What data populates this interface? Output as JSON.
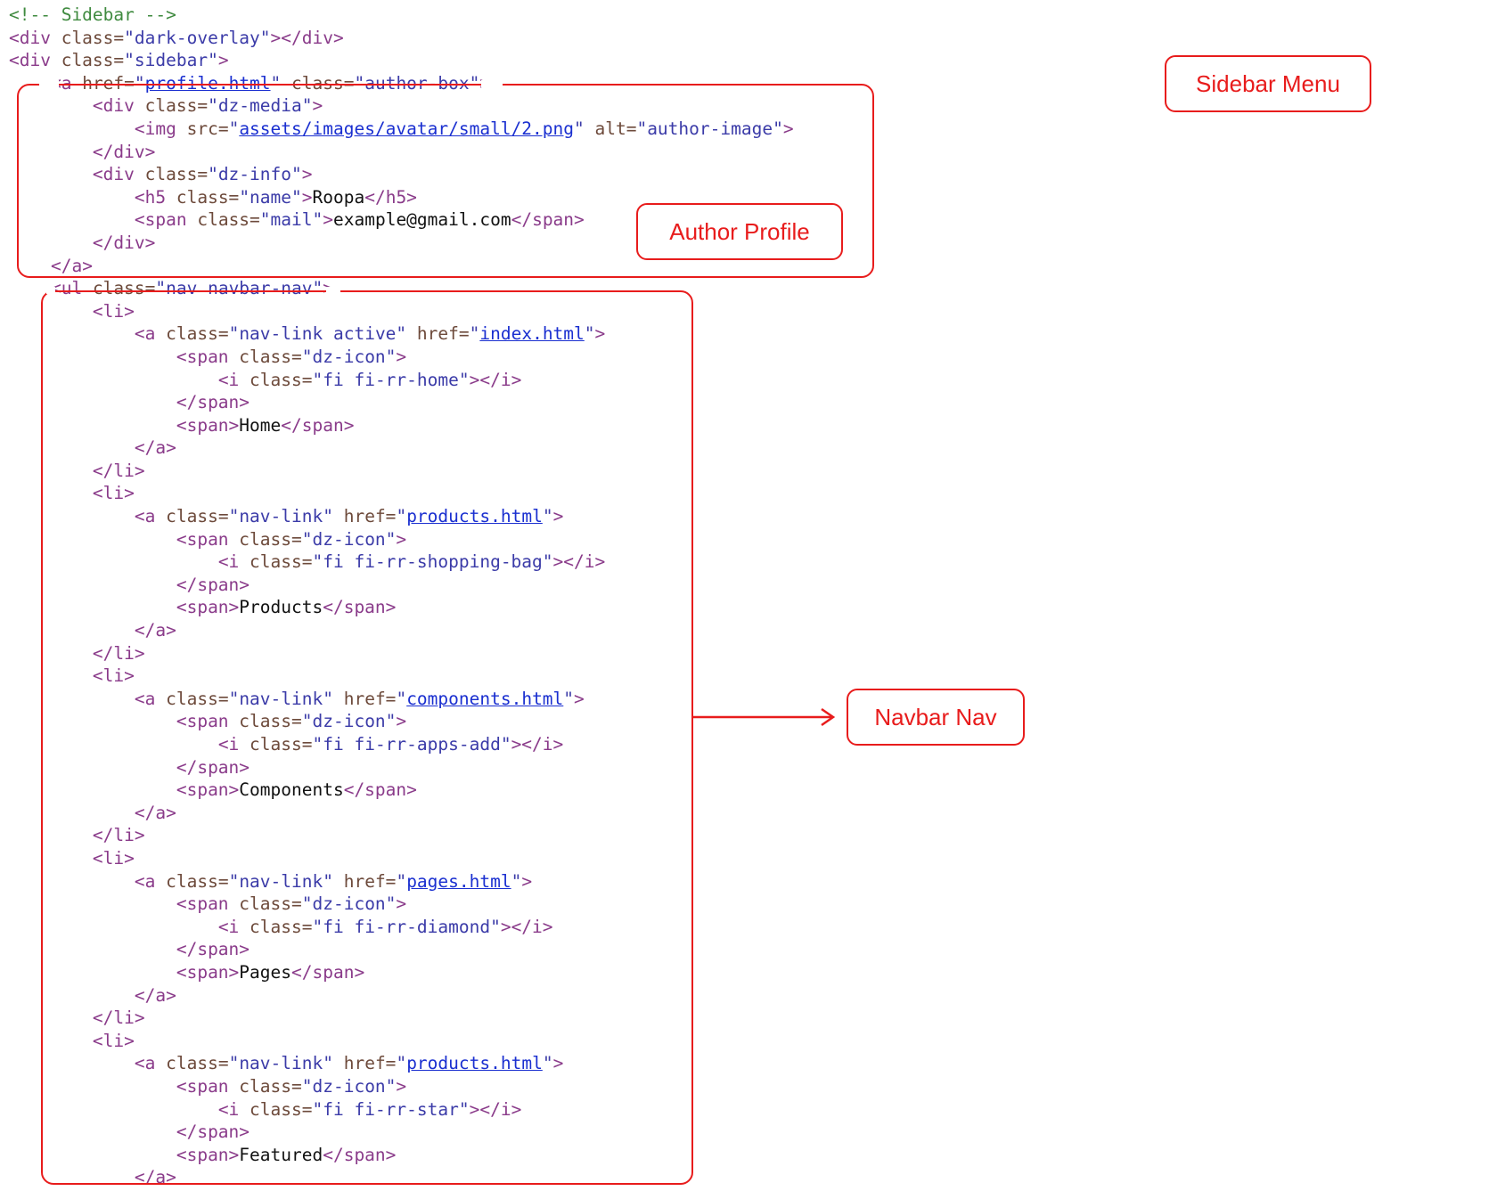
{
  "labels": {
    "sidebar_menu": "Sidebar Menu",
    "author_profile": "Author Profile",
    "navbar_nav": "Navbar Nav"
  },
  "colors": {
    "annotation": "#e81c1c",
    "comment": "#3f8a3f",
    "tag": "#8a3b8a",
    "attr": "#6d4a3b",
    "value": "#3b3ba8",
    "link": "#1a2fd0",
    "text": "#111111"
  },
  "code_lines": [
    {
      "indent": 0,
      "tokens": [
        {
          "t": "comment",
          "v": "<!-- Sidebar -->"
        }
      ]
    },
    {
      "indent": 0,
      "tokens": [
        {
          "t": "tag",
          "v": "<div "
        },
        {
          "t": "attr",
          "v": "class="
        },
        {
          "t": "val",
          "v": "\"dark-overlay\""
        },
        {
          "t": "tag",
          "v": "></div>"
        }
      ]
    },
    {
      "indent": 0,
      "tokens": [
        {
          "t": "tag",
          "v": "<div "
        },
        {
          "t": "attr",
          "v": "class="
        },
        {
          "t": "val",
          "v": "\"sidebar\""
        },
        {
          "t": "tag",
          "v": ">"
        }
      ]
    },
    {
      "indent": 1,
      "tokens": [
        {
          "t": "tag",
          "v": "<a "
        },
        {
          "t": "attr",
          "v": "href="
        },
        {
          "t": "val",
          "v": "\""
        },
        {
          "t": "link",
          "v": "profile.html"
        },
        {
          "t": "val",
          "v": "\""
        },
        {
          "t": "attr",
          "v": " class="
        },
        {
          "t": "val",
          "v": "\"author-box\""
        },
        {
          "t": "tag",
          "v": ">"
        }
      ]
    },
    {
      "indent": 2,
      "tokens": [
        {
          "t": "tag",
          "v": "<div "
        },
        {
          "t": "attr",
          "v": "class="
        },
        {
          "t": "val",
          "v": "\"dz-media\""
        },
        {
          "t": "tag",
          "v": ">"
        }
      ]
    },
    {
      "indent": 3,
      "tokens": [
        {
          "t": "tag",
          "v": "<img "
        },
        {
          "t": "attr",
          "v": "src="
        },
        {
          "t": "val",
          "v": "\""
        },
        {
          "t": "link",
          "v": "assets/images/avatar/small/2.png"
        },
        {
          "t": "val",
          "v": "\""
        },
        {
          "t": "attr",
          "v": " alt="
        },
        {
          "t": "val",
          "v": "\"author-image\""
        },
        {
          "t": "tag",
          "v": ">"
        }
      ]
    },
    {
      "indent": 2,
      "tokens": [
        {
          "t": "tag",
          "v": "</div>"
        }
      ]
    },
    {
      "indent": 2,
      "tokens": [
        {
          "t": "tag",
          "v": "<div "
        },
        {
          "t": "attr",
          "v": "class="
        },
        {
          "t": "val",
          "v": "\"dz-info\""
        },
        {
          "t": "tag",
          "v": ">"
        }
      ]
    },
    {
      "indent": 3,
      "tokens": [
        {
          "t": "tag",
          "v": "<h5 "
        },
        {
          "t": "attr",
          "v": "class="
        },
        {
          "t": "val",
          "v": "\"name\""
        },
        {
          "t": "tag",
          "v": ">"
        },
        {
          "t": "text",
          "v": "Roopa"
        },
        {
          "t": "tag",
          "v": "</h5>"
        }
      ]
    },
    {
      "indent": 3,
      "tokens": [
        {
          "t": "tag",
          "v": "<span "
        },
        {
          "t": "attr",
          "v": "class="
        },
        {
          "t": "val",
          "v": "\"mail\""
        },
        {
          "t": "tag",
          "v": ">"
        },
        {
          "t": "text",
          "v": "example@gmail.com"
        },
        {
          "t": "tag",
          "v": "</span>"
        }
      ]
    },
    {
      "indent": 2,
      "tokens": [
        {
          "t": "tag",
          "v": "</div>"
        }
      ]
    },
    {
      "indent": 1,
      "tokens": [
        {
          "t": "tag",
          "v": "</a>"
        }
      ]
    },
    {
      "indent": 1,
      "tokens": [
        {
          "t": "tag",
          "v": "<ul "
        },
        {
          "t": "attr",
          "v": "class="
        },
        {
          "t": "val",
          "v": "\"nav navbar-nav\""
        },
        {
          "t": "tag",
          "v": ">"
        }
      ]
    },
    {
      "indent": 2,
      "tokens": [
        {
          "t": "tag",
          "v": "<li>"
        }
      ]
    },
    {
      "indent": 3,
      "tokens": [
        {
          "t": "tag",
          "v": "<a "
        },
        {
          "t": "attr",
          "v": "class="
        },
        {
          "t": "val",
          "v": "\"nav-link active\""
        },
        {
          "t": "attr",
          "v": " href="
        },
        {
          "t": "val",
          "v": "\""
        },
        {
          "t": "link",
          "v": "index.html"
        },
        {
          "t": "val",
          "v": "\""
        },
        {
          "t": "tag",
          "v": ">"
        }
      ]
    },
    {
      "indent": 4,
      "tokens": [
        {
          "t": "tag",
          "v": "<span "
        },
        {
          "t": "attr",
          "v": "class="
        },
        {
          "t": "val",
          "v": "\"dz-icon\""
        },
        {
          "t": "tag",
          "v": ">"
        }
      ]
    },
    {
      "indent": 5,
      "tokens": [
        {
          "t": "tag",
          "v": "<i "
        },
        {
          "t": "attr",
          "v": "class="
        },
        {
          "t": "val",
          "v": "\"fi fi-rr-home\""
        },
        {
          "t": "tag",
          "v": "></i>"
        }
      ]
    },
    {
      "indent": 4,
      "tokens": [
        {
          "t": "tag",
          "v": "</span>"
        }
      ]
    },
    {
      "indent": 4,
      "tokens": [
        {
          "t": "tag",
          "v": "<span>"
        },
        {
          "t": "text",
          "v": "Home"
        },
        {
          "t": "tag",
          "v": "</span>"
        }
      ]
    },
    {
      "indent": 3,
      "tokens": [
        {
          "t": "tag",
          "v": "</a>"
        }
      ]
    },
    {
      "indent": 2,
      "tokens": [
        {
          "t": "tag",
          "v": "</li>"
        }
      ]
    },
    {
      "indent": 2,
      "tokens": [
        {
          "t": "tag",
          "v": "<li>"
        }
      ]
    },
    {
      "indent": 3,
      "tokens": [
        {
          "t": "tag",
          "v": "<a "
        },
        {
          "t": "attr",
          "v": "class="
        },
        {
          "t": "val",
          "v": "\"nav-link\""
        },
        {
          "t": "attr",
          "v": " href="
        },
        {
          "t": "val",
          "v": "\""
        },
        {
          "t": "link",
          "v": "products.html"
        },
        {
          "t": "val",
          "v": "\""
        },
        {
          "t": "tag",
          "v": ">"
        }
      ]
    },
    {
      "indent": 4,
      "tokens": [
        {
          "t": "tag",
          "v": "<span "
        },
        {
          "t": "attr",
          "v": "class="
        },
        {
          "t": "val",
          "v": "\"dz-icon\""
        },
        {
          "t": "tag",
          "v": ">"
        }
      ]
    },
    {
      "indent": 5,
      "tokens": [
        {
          "t": "tag",
          "v": "<i "
        },
        {
          "t": "attr",
          "v": "class="
        },
        {
          "t": "val",
          "v": "\"fi fi-rr-shopping-bag\""
        },
        {
          "t": "tag",
          "v": "></i>"
        }
      ]
    },
    {
      "indent": 4,
      "tokens": [
        {
          "t": "tag",
          "v": "</span>"
        }
      ]
    },
    {
      "indent": 4,
      "tokens": [
        {
          "t": "tag",
          "v": "<span>"
        },
        {
          "t": "text",
          "v": "Products"
        },
        {
          "t": "tag",
          "v": "</span>"
        }
      ]
    },
    {
      "indent": 3,
      "tokens": [
        {
          "t": "tag",
          "v": "</a>"
        }
      ]
    },
    {
      "indent": 2,
      "tokens": [
        {
          "t": "tag",
          "v": "</li>"
        }
      ]
    },
    {
      "indent": 2,
      "tokens": [
        {
          "t": "tag",
          "v": "<li>"
        }
      ]
    },
    {
      "indent": 3,
      "tokens": [
        {
          "t": "tag",
          "v": "<a "
        },
        {
          "t": "attr",
          "v": "class="
        },
        {
          "t": "val",
          "v": "\"nav-link\""
        },
        {
          "t": "attr",
          "v": " href="
        },
        {
          "t": "val",
          "v": "\""
        },
        {
          "t": "link",
          "v": "components.html"
        },
        {
          "t": "val",
          "v": "\""
        },
        {
          "t": "tag",
          "v": ">"
        }
      ]
    },
    {
      "indent": 4,
      "tokens": [
        {
          "t": "tag",
          "v": "<span "
        },
        {
          "t": "attr",
          "v": "class="
        },
        {
          "t": "val",
          "v": "\"dz-icon\""
        },
        {
          "t": "tag",
          "v": ">"
        }
      ]
    },
    {
      "indent": 5,
      "tokens": [
        {
          "t": "tag",
          "v": "<i "
        },
        {
          "t": "attr",
          "v": "class="
        },
        {
          "t": "val",
          "v": "\"fi fi-rr-apps-add\""
        },
        {
          "t": "tag",
          "v": "></i>"
        }
      ]
    },
    {
      "indent": 4,
      "tokens": [
        {
          "t": "tag",
          "v": "</span>"
        }
      ]
    },
    {
      "indent": 4,
      "tokens": [
        {
          "t": "tag",
          "v": "<span>"
        },
        {
          "t": "text",
          "v": "Components"
        },
        {
          "t": "tag",
          "v": "</span>"
        }
      ]
    },
    {
      "indent": 3,
      "tokens": [
        {
          "t": "tag",
          "v": "</a>"
        }
      ]
    },
    {
      "indent": 2,
      "tokens": [
        {
          "t": "tag",
          "v": "</li>"
        }
      ]
    },
    {
      "indent": 2,
      "tokens": [
        {
          "t": "tag",
          "v": "<li>"
        }
      ]
    },
    {
      "indent": 3,
      "tokens": [
        {
          "t": "tag",
          "v": "<a "
        },
        {
          "t": "attr",
          "v": "class="
        },
        {
          "t": "val",
          "v": "\"nav-link\""
        },
        {
          "t": "attr",
          "v": " href="
        },
        {
          "t": "val",
          "v": "\""
        },
        {
          "t": "link",
          "v": "pages.html"
        },
        {
          "t": "val",
          "v": "\""
        },
        {
          "t": "tag",
          "v": ">"
        }
      ]
    },
    {
      "indent": 4,
      "tokens": [
        {
          "t": "tag",
          "v": "<span "
        },
        {
          "t": "attr",
          "v": "class="
        },
        {
          "t": "val",
          "v": "\"dz-icon\""
        },
        {
          "t": "tag",
          "v": ">"
        }
      ]
    },
    {
      "indent": 5,
      "tokens": [
        {
          "t": "tag",
          "v": "<i "
        },
        {
          "t": "attr",
          "v": "class="
        },
        {
          "t": "val",
          "v": "\"fi fi-rr-diamond\""
        },
        {
          "t": "tag",
          "v": "></i>"
        }
      ]
    },
    {
      "indent": 4,
      "tokens": [
        {
          "t": "tag",
          "v": "</span>"
        }
      ]
    },
    {
      "indent": 4,
      "tokens": [
        {
          "t": "tag",
          "v": "<span>"
        },
        {
          "t": "text",
          "v": "Pages"
        },
        {
          "t": "tag",
          "v": "</span>"
        }
      ]
    },
    {
      "indent": 3,
      "tokens": [
        {
          "t": "tag",
          "v": "</a>"
        }
      ]
    },
    {
      "indent": 2,
      "tokens": [
        {
          "t": "tag",
          "v": "</li>"
        }
      ]
    },
    {
      "indent": 2,
      "tokens": [
        {
          "t": "tag",
          "v": "<li>"
        }
      ]
    },
    {
      "indent": 3,
      "tokens": [
        {
          "t": "tag",
          "v": "<a "
        },
        {
          "t": "attr",
          "v": "class="
        },
        {
          "t": "val",
          "v": "\"nav-link\""
        },
        {
          "t": "attr",
          "v": " href="
        },
        {
          "t": "val",
          "v": "\""
        },
        {
          "t": "link",
          "v": "products.html"
        },
        {
          "t": "val",
          "v": "\""
        },
        {
          "t": "tag",
          "v": ">"
        }
      ]
    },
    {
      "indent": 4,
      "tokens": [
        {
          "t": "tag",
          "v": "<span "
        },
        {
          "t": "attr",
          "v": "class="
        },
        {
          "t": "val",
          "v": "\"dz-icon\""
        },
        {
          "t": "tag",
          "v": ">"
        }
      ]
    },
    {
      "indent": 5,
      "tokens": [
        {
          "t": "tag",
          "v": "<i "
        },
        {
          "t": "attr",
          "v": "class="
        },
        {
          "t": "val",
          "v": "\"fi fi-rr-star\""
        },
        {
          "t": "tag",
          "v": "></i>"
        }
      ]
    },
    {
      "indent": 4,
      "tokens": [
        {
          "t": "tag",
          "v": "</span>"
        }
      ]
    },
    {
      "indent": 4,
      "tokens": [
        {
          "t": "tag",
          "v": "<span>"
        },
        {
          "t": "text",
          "v": "Featured"
        },
        {
          "t": "tag",
          "v": "</span>"
        }
      ]
    },
    {
      "indent": 3,
      "tokens": [
        {
          "t": "tag",
          "v": "</a>"
        }
      ]
    }
  ]
}
